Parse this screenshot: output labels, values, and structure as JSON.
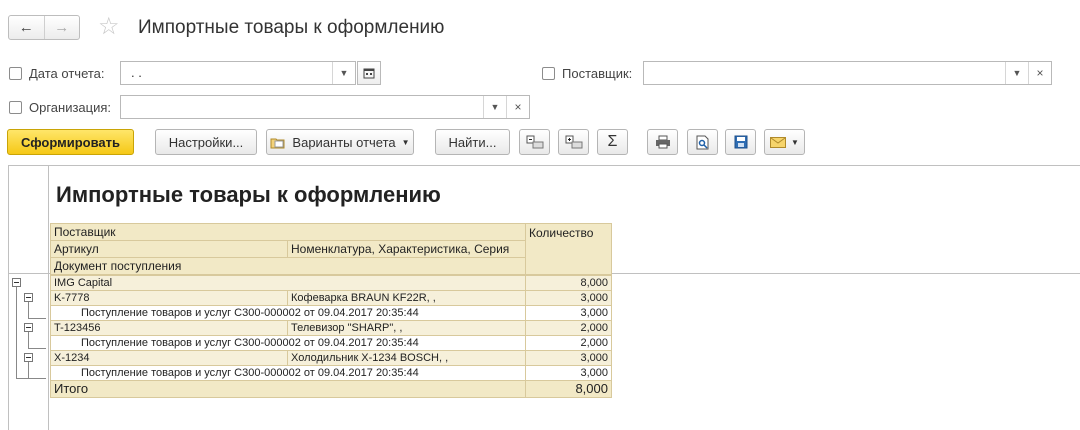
{
  "window": {
    "title": "Импортные товары к оформлению",
    "back": "←",
    "forward": "→",
    "favorite": "☆"
  },
  "filters": {
    "report_date": {
      "label": "Дата отчета:",
      "value": ".  ."
    },
    "supplier": {
      "label": "Поставщик:",
      "value": ""
    },
    "organization": {
      "label": "Организация:",
      "value": ""
    }
  },
  "toolbar": {
    "generate": "Сформировать",
    "settings": "Настройки...",
    "variants": "Варианты отчета",
    "find": "Найти...",
    "sum": "Σ"
  },
  "report": {
    "title": "Импортные товары к оформлению",
    "headers": {
      "supplier": "Поставщик",
      "quantity": "Количество",
      "article": "Артикул",
      "nomenclature": "Номенклатура, Характеристика, Серия",
      "receipt_doc": "Документ поступления"
    },
    "supplier_row": {
      "name": "IMG Capital",
      "qty": "8,000"
    },
    "items": [
      {
        "article": "K-7778",
        "name": "Кофеварка BRAUN KF22R, ,",
        "qty": "3,000",
        "doc": "Поступление товаров и услуг С300-000002 от 09.04.2017 20:35:44",
        "doc_qty": "3,000"
      },
      {
        "article": "T-123456",
        "name": "Телевизор \"SHARP\", ,",
        "qty": "2,000",
        "doc": "Поступление товаров и услуг С300-000002 от 09.04.2017 20:35:44",
        "doc_qty": "2,000"
      },
      {
        "article": "X-1234",
        "name": "Холодильник X-1234 BOSCH, ,",
        "qty": "3,000",
        "doc": "Поступление товаров и услуг С300-000002 от 09.04.2017 20:35:44",
        "doc_qty": "3,000"
      }
    ],
    "total": {
      "label": "Итого",
      "qty": "8,000"
    }
  }
}
